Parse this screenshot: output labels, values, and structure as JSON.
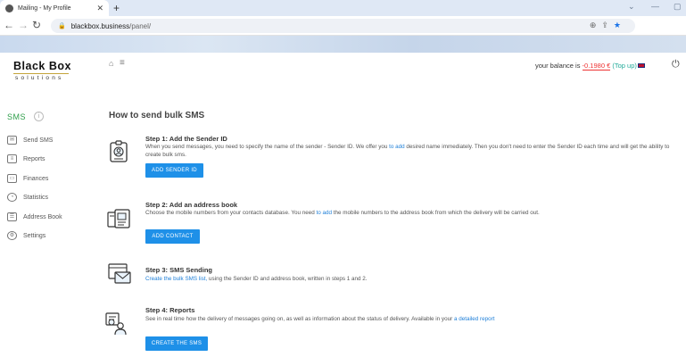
{
  "browser": {
    "tab_title": "Mailing - My Profile",
    "new_tab": "+",
    "url_domain": "blackbox.business",
    "url_path": "/panel/"
  },
  "header": {
    "logo_main": "Black Box",
    "logo_sub": "solutions",
    "balance_label": "your balance is",
    "balance_amount": "-0.1980 €",
    "topup_label": "(Top up)"
  },
  "sidebar": {
    "title": "SMS",
    "items": [
      {
        "label": "Send SMS",
        "icon": "envelope-icon"
      },
      {
        "label": "Reports",
        "icon": "document-icon"
      },
      {
        "label": "Finances",
        "icon": "wallet-icon"
      },
      {
        "label": "Statistics",
        "icon": "pie-chart-icon"
      },
      {
        "label": "Address Book",
        "icon": "address-book-icon"
      },
      {
        "label": "Settings",
        "icon": "gear-icon"
      }
    ]
  },
  "main": {
    "title": "How to send bulk SMS",
    "steps": [
      {
        "title": "Step 1: Add the Sender ID",
        "desc_before": "When you send messages, you need to specify the name of the sender - Sender ID. We offer you ",
        "desc_link": "to add",
        "desc_after": " desired name immediately. Then you don't need to enter the Sender ID each time and will get the ability to create bulk sms.",
        "button": "ADD SENDER ID"
      },
      {
        "title": "Step 2: Add an address book",
        "desc_before": "Choose the mobile numbers from your contacts database. You need ",
        "desc_link": "to add",
        "desc_after": " the mobile numbers to the address book from which the delivery will be carried out.",
        "button": "ADD CONTACT"
      },
      {
        "title": "Step 3: SMS Sending",
        "desc_link": "Create the bulk SMS list,",
        "desc_after": " using the Sender ID and address book, written in steps 1 and 2."
      },
      {
        "title": "Step 4: Reports",
        "desc_before": "See in real time how the delivery of messages going on, as well as information about the status of delivery. Available in your ",
        "desc_link": "a detailed report",
        "button": "CREATE THE SMS"
      }
    ]
  },
  "colors": {
    "accent_blue": "#1e90e8",
    "sms_green": "#2e9e4a",
    "balance_red": "#e33"
  }
}
